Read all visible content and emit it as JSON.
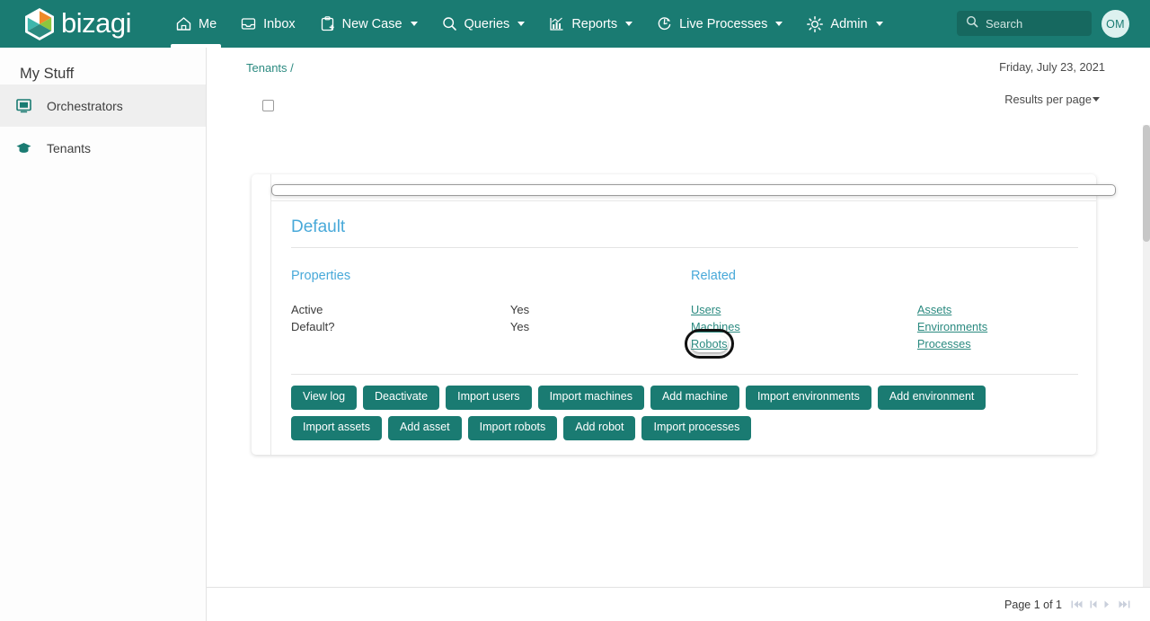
{
  "topbar": {
    "brand": "bizagi",
    "brand_icon": "bizagi-hexagon-logo",
    "nav": [
      {
        "label": "Me",
        "icon": "home-icon",
        "caret": false,
        "active": true
      },
      {
        "label": "Inbox",
        "icon": "inbox-icon",
        "caret": false,
        "active": false
      },
      {
        "label": "New Case",
        "icon": "new-case-icon",
        "caret": true,
        "active": false
      },
      {
        "label": "Queries",
        "icon": "search-icon",
        "caret": true,
        "active": false
      },
      {
        "label": "Reports",
        "icon": "reports-chart-icon",
        "caret": true,
        "active": false
      },
      {
        "label": "Live Processes",
        "icon": "live-processes-icon",
        "caret": true,
        "active": false
      },
      {
        "label": "Admin",
        "icon": "gear-icon",
        "caret": true,
        "active": false
      }
    ],
    "search": {
      "placeholder": "Search",
      "value": "",
      "icon": "search-icon"
    },
    "avatar": {
      "initials": "OM"
    },
    "bg_color": "#1a7b72"
  },
  "sidebar": {
    "title": "My Stuff",
    "items": [
      {
        "label": "Orchestrators",
        "icon": "monitor-icon",
        "selected": true
      },
      {
        "label": "Tenants",
        "icon": "graduation-cap-icon",
        "selected": false
      }
    ]
  },
  "main": {
    "breadcrumb": "Tenants /",
    "date": "Friday, July 23, 2021",
    "results_per_page": "Results per page",
    "select_all_checked": false
  },
  "card": {
    "checked": false,
    "title": "Default",
    "properties_label": "Properties",
    "related_label": "Related",
    "properties": [
      {
        "name": "Active",
        "value": "Yes"
      },
      {
        "name": "Default?",
        "value": "Yes"
      }
    ],
    "related_col1": [
      {
        "label": "Users",
        "focused": false
      },
      {
        "label": "Machines",
        "focused": false
      },
      {
        "label": "Robots",
        "focused": true
      }
    ],
    "related_col2": [
      {
        "label": "Assets",
        "focused": false
      },
      {
        "label": "Environments",
        "focused": false
      },
      {
        "label": "Processes",
        "focused": false
      }
    ],
    "buttons": [
      "View log",
      "Deactivate",
      "Import users",
      "Import machines",
      "Add machine",
      "Import environments",
      "Add environment",
      "Import assets",
      "Add asset",
      "Import robots",
      "Add robot",
      "Import processes"
    ],
    "accent_color": "#48a9d9",
    "link_color": "#2b8a80",
    "button_color": "#1a7b72"
  },
  "footer": {
    "page_text": "Page 1 of 1",
    "pager": [
      "first-page-icon",
      "prev-page-icon",
      "next-page-icon",
      "last-page-icon"
    ]
  }
}
